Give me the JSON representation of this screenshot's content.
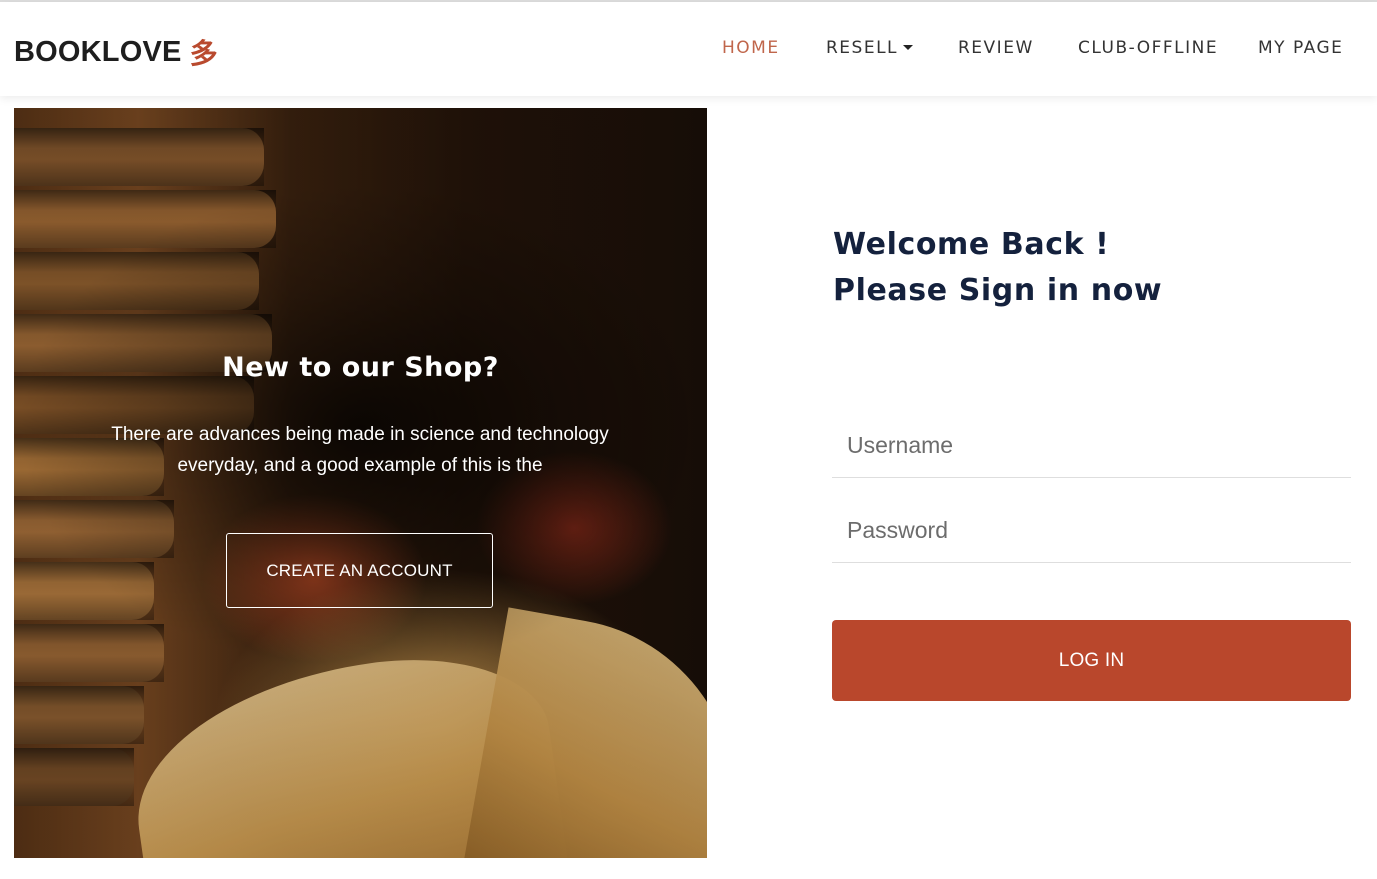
{
  "header": {
    "brand": "BOOKLOVE",
    "brand_mark": "多",
    "nav": [
      {
        "label": "HOME",
        "active": true
      },
      {
        "label": "RESELL",
        "dropdown": true
      },
      {
        "label": "REVIEW"
      },
      {
        "label": "CLUB-OFFLINE"
      },
      {
        "label": "MY PAGE"
      }
    ]
  },
  "hero": {
    "title": "New to our Shop?",
    "text": "There are advances being made in science and technology everyday, and a good example of this is the",
    "button": "CREATE AN ACCOUNT"
  },
  "login": {
    "heading_line1": "Welcome Back !",
    "heading_line2": "Please Sign in now",
    "username_placeholder": "Username",
    "password_placeholder": "Password",
    "button": "LOG IN"
  },
  "colors": {
    "accent": "#b9472c",
    "nav_active": "#c0664b",
    "heading": "#14213d"
  }
}
